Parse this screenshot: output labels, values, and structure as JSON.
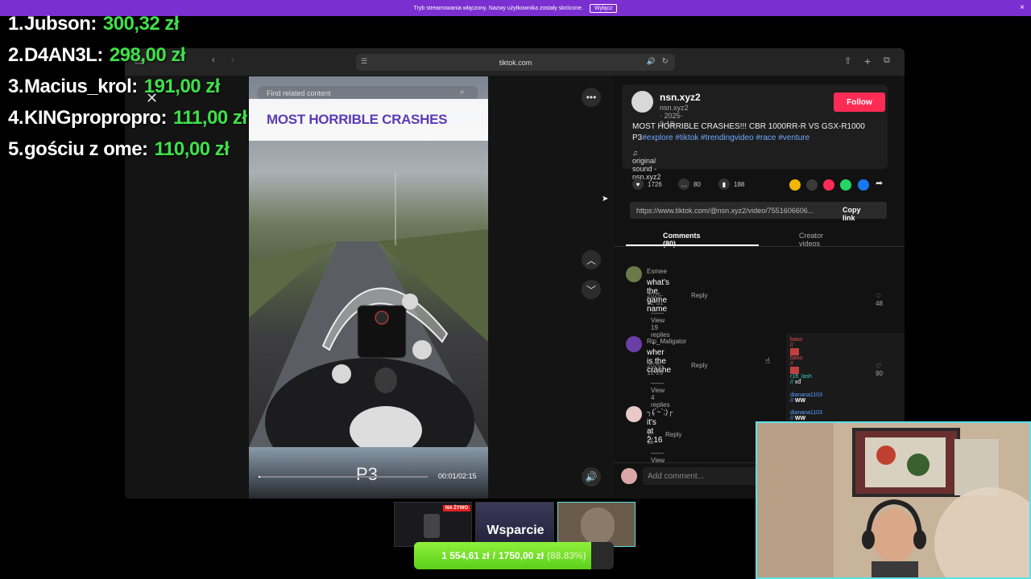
{
  "stream_banner": {
    "message": "Tryb streamowania włączony. Nazwy użytkownika zostały skrócone.",
    "button_label": "Wyłącz",
    "close_glyph": "×"
  },
  "leaderboard": [
    {
      "rank": "1.",
      "name": "Jubson:",
      "amount": "300,32 zł"
    },
    {
      "rank": "2.",
      "name": "D4AN3L:",
      "amount": "298,00 zł"
    },
    {
      "rank": "3.",
      "name": "Macius_krol:",
      "amount": "191,00 zł"
    },
    {
      "rank": "4.",
      "name": "KINGpropropro:",
      "amount": "111,00 zł"
    },
    {
      "rank": "5.",
      "name": "gościu z ome:",
      "amount": "110,00 zł"
    }
  ],
  "browser": {
    "url": "tiktok.com"
  },
  "video": {
    "search_placeholder": "Find related content",
    "caption": "MOST HORRIBLE CRASHES",
    "overlay_text": "P3",
    "time": "00:01/02:15",
    "progress": 0.008
  },
  "post": {
    "author": "nsn.xyz2",
    "meta": "nsn.xyz2 · 2025-9-19",
    "follow_label": "Follow",
    "description": "MOST HORRIBLE CRASHES!!! CBR 1000RR-R VS GSX-R1000 P3",
    "tags": "#explore #tiktok #trendingvideo #race #venture",
    "sound": "original sound - nsn.xyz2",
    "likes": "1726",
    "comments_count": "80",
    "saves": "188",
    "link": "https://www.tiktok.com/@nsn.xyz2/video/7551606606...",
    "copy_link_label": "Copy link"
  },
  "tabs": {
    "comments": "Comments (80)",
    "creator": "Creator videos"
  },
  "comments": [
    {
      "user": "Esmee",
      "text": "what's the game name",
      "date": "2025-12-31",
      "reply": "Reply",
      "likes": "48",
      "views": "View 19 replies"
    },
    {
      "user": "Rip_Maligator",
      "text": "wher is the crashe",
      "date": "2025-12-29",
      "reply": "Reply",
      "likes": "90",
      "views": "View 4 replies"
    },
    {
      "user": "┐(´~`;)┌",
      "text": "it's at 2:16",
      "date": "1-11",
      "reply": "Reply",
      "likes": "",
      "views": "View 5 replies"
    }
  ],
  "add_comment_placeholder": "Add comment...",
  "chat": [
    {
      "user": "baso",
      "msg": ""
    },
    {
      "user": "baso",
      "msg": ""
    },
    {
      "user": "r1ft_lash",
      "msg": "xd"
    },
    {
      "user": "dianana1103",
      "msg": "WW"
    },
    {
      "user": "dianana1103",
      "msg": "WW"
    }
  ],
  "thumbnails": {
    "live_badge": "NA ŻYWO",
    "support_label": "Wsparcie"
  },
  "goal": {
    "current": "1 554,61 zł",
    "separator": "/",
    "target": "1750,00 zł",
    "percent": "(88.83%)",
    "fraction": 0.8883
  },
  "colors": {
    "banner": "#7b2fd0",
    "follow": "#fe2c55",
    "leader_amount": "#3fe04a",
    "goal_fill": "#6ee020",
    "webcam_border": "#5de0e8"
  }
}
